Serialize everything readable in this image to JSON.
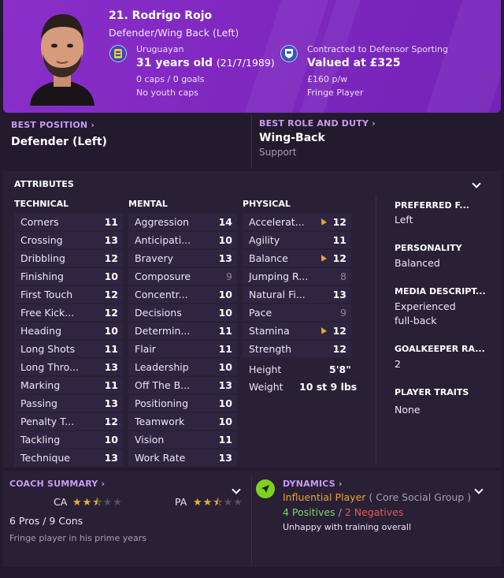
{
  "player": {
    "name": "21. Rodrigo Rojo",
    "position": "Defender/Wing Back (Left)",
    "nationality": "Uruguayan",
    "age_line": "31 years old",
    "dob": "(21/7/1989)",
    "caps": "0 caps / 0 goals",
    "youth": "No youth caps",
    "contract": "Contracted to Defensor Sporting",
    "value": "Valued at £325",
    "wage": "£160 p/w",
    "squad_status": "Fringe Player"
  },
  "best_position": {
    "label": "BEST POSITION",
    "value": "Defender (Left)"
  },
  "best_role": {
    "label": "BEST ROLE AND DUTY",
    "value": "Wing-Back",
    "duty": "Support"
  },
  "attributes": {
    "title": "ATTRIBUTES",
    "technical_head": "TECHNICAL",
    "mental_head": "MENTAL",
    "physical_head": "PHYSICAL",
    "technical": [
      {
        "name": "Corners",
        "value": "11"
      },
      {
        "name": "Crossing",
        "value": "13"
      },
      {
        "name": "Dribbling",
        "value": "12"
      },
      {
        "name": "Finishing",
        "value": "10"
      },
      {
        "name": "First Touch",
        "value": "12"
      },
      {
        "name": "Free Kick...",
        "value": "12"
      },
      {
        "name": "Heading",
        "value": "10"
      },
      {
        "name": "Long Shots",
        "value": "11"
      },
      {
        "name": "Long Thro...",
        "value": "13"
      },
      {
        "name": "Marking",
        "value": "11"
      },
      {
        "name": "Passing",
        "value": "13"
      },
      {
        "name": "Penalty T...",
        "value": "12"
      },
      {
        "name": "Tackling",
        "value": "10"
      },
      {
        "name": "Technique",
        "value": "13"
      }
    ],
    "mental": [
      {
        "name": "Aggression",
        "value": "14"
      },
      {
        "name": "Anticipati...",
        "value": "10"
      },
      {
        "name": "Bravery",
        "value": "13"
      },
      {
        "name": "Composure",
        "value": "9"
      },
      {
        "name": "Concentr...",
        "value": "10"
      },
      {
        "name": "Decisions",
        "value": "10"
      },
      {
        "name": "Determin...",
        "value": "11"
      },
      {
        "name": "Flair",
        "value": "11"
      },
      {
        "name": "Leadership",
        "value": "10"
      },
      {
        "name": "Off The B...",
        "value": "13"
      },
      {
        "name": "Positioning",
        "value": "10"
      },
      {
        "name": "Teamwork",
        "value": "10"
      },
      {
        "name": "Vision",
        "value": "11"
      },
      {
        "name": "Work Rate",
        "value": "13"
      }
    ],
    "physical": [
      {
        "name": "Accelerat...",
        "value": "12"
      },
      {
        "name": "Agility",
        "value": "11"
      },
      {
        "name": "Balance",
        "value": "12"
      },
      {
        "name": "Jumping R...",
        "value": "8"
      },
      {
        "name": "Natural Fi...",
        "value": "13"
      },
      {
        "name": "Pace",
        "value": "9"
      },
      {
        "name": "Stamina",
        "value": "12"
      },
      {
        "name": "Strength",
        "value": "12"
      }
    ],
    "height_label": "Height",
    "height": "5'8\"",
    "weight_label": "Weight",
    "weight": "10 st 9 lbs"
  },
  "side": {
    "preferred_foot_label": "PREFERRED F...",
    "preferred_foot": "Left",
    "personality_label": "PERSONALITY",
    "personality": "Balanced",
    "media_label": "MEDIA DESCRIPT...",
    "media_line1": "Experienced",
    "media_line2": "full-back",
    "gk_label": "GOALKEEPER RA...",
    "gk_value": "2",
    "traits_label": "PLAYER TRAITS",
    "traits_value": "None"
  },
  "coach": {
    "label": "COACH SUMMARY",
    "ca_label": "CA",
    "ca_stars": 2.5,
    "pa_label": "PA",
    "pa_stars": 2.5,
    "pros_cons": "6 Pros / 9 Cons",
    "summary": "Fringe player in his prime years"
  },
  "dynamics": {
    "label": "DYNAMICS",
    "status": "Influential Player",
    "group": "( Core Social Group )",
    "positives": "4 Positives",
    "separator": "/",
    "negatives": "2 Negatives",
    "note": "Unhappy with training overall"
  },
  "colors": {
    "accent": "#c79bf2",
    "header": "#7d27bf",
    "star": "#e2b23a",
    "positive": "#7bd86a",
    "negative": "#e05a5a",
    "influential": "#e8a33a"
  }
}
